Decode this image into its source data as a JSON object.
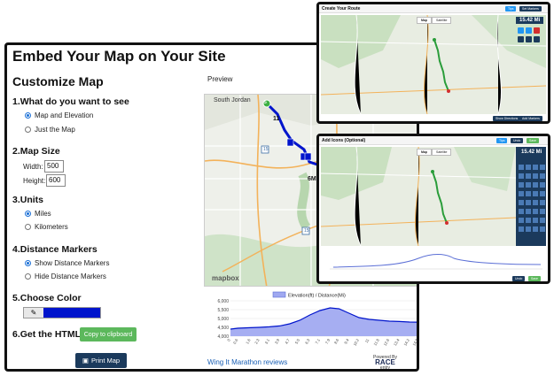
{
  "embed": {
    "title": "Embed Your Map on Your Site",
    "customize_title": "Customize Map",
    "preview_label": "Preview",
    "sections": {
      "what": {
        "title": "1.What do you want to see",
        "options": [
          "Map and Elevation",
          "Just the Map"
        ],
        "selected": 0
      },
      "size": {
        "title": "2.Map Size",
        "width_label": "Width:",
        "width_value": "500",
        "height_label": "Height:",
        "height_value": "600"
      },
      "units": {
        "title": "3.Units",
        "options": [
          "Miles",
          "Kilometers"
        ],
        "selected": 0
      },
      "markers": {
        "title": "4.Distance Markers",
        "options": [
          "Show Distance Markers",
          "Hide Distance Markers"
        ],
        "selected": 0
      },
      "color": {
        "title": "5.Choose Color",
        "value": "#0014cc"
      },
      "html": {
        "title": "6.Get the HTML:",
        "copy_label": "Copy to clipboard"
      }
    },
    "print_label": "Print Map",
    "reviews_link": "Wing It Marathon reviews",
    "powered_by": "Powered By",
    "brand": "RACE",
    "brand_sub": "entry",
    "map_labels": {
      "city": "South Jordan",
      "mapbox": "mapbox",
      "hw1": "15",
      "hw2": "15",
      "marker_start": "5",
      "marker_a": "11",
      "marker_b": "6M"
    },
    "elevation": {
      "legend": "Elevation(ft) / Distance(Mi)",
      "y_ticks": [
        "6,000",
        "5,500",
        "5,000",
        "4,500",
        "4,000"
      ],
      "x_ticks": [
        "0",
        "0.6",
        "1.6",
        "2.3",
        "3.1",
        "3.9",
        "4.7",
        "5.5",
        "6.3",
        "7.1",
        "7.9",
        "8.6",
        "9.4",
        "10.2",
        "11",
        "11.8",
        "12.6",
        "13.4",
        "14.2",
        "14.9"
      ]
    }
  },
  "route_panel": {
    "title": "Create Your Route",
    "buttons": [
      "Tips",
      "Set Markers"
    ],
    "tabs": [
      "Map",
      "Satellite"
    ],
    "distance": "15.42 Mi",
    "bottom_buttons": [
      "Show Directions",
      "Add Markers"
    ]
  },
  "icons_panel": {
    "title": "Add Icons (Optional)",
    "buttons": [
      "Tips",
      "Undo",
      "Save"
    ],
    "tabs": [
      "Map",
      "Satellite"
    ],
    "distance": "15.42 Mi",
    "bottom_buttons": [
      "Undo",
      "Save"
    ]
  },
  "chart_data": {
    "type": "area",
    "title": "",
    "xlabel": "Distance(Mi)",
    "ylabel": "Elevation(ft)",
    "legend": "Elevation(ft) / Distance(Mi)",
    "ylim": [
      4000,
      6000
    ],
    "x": [
      0,
      0.6,
      1.6,
      2.3,
      3.1,
      3.9,
      4.7,
      5.5,
      6.3,
      7.1,
      7.9,
      8.6,
      9.4,
      10.2,
      11,
      11.8,
      12.6,
      13.4,
      14.2,
      14.9
    ],
    "values": [
      4400,
      4450,
      4480,
      4500,
      4530,
      4580,
      4700,
      4900,
      5200,
      5450,
      5600,
      5550,
      5300,
      5050,
      4950,
      4900,
      4850,
      4830,
      4800,
      4790
    ],
    "color": "#0014cc"
  }
}
